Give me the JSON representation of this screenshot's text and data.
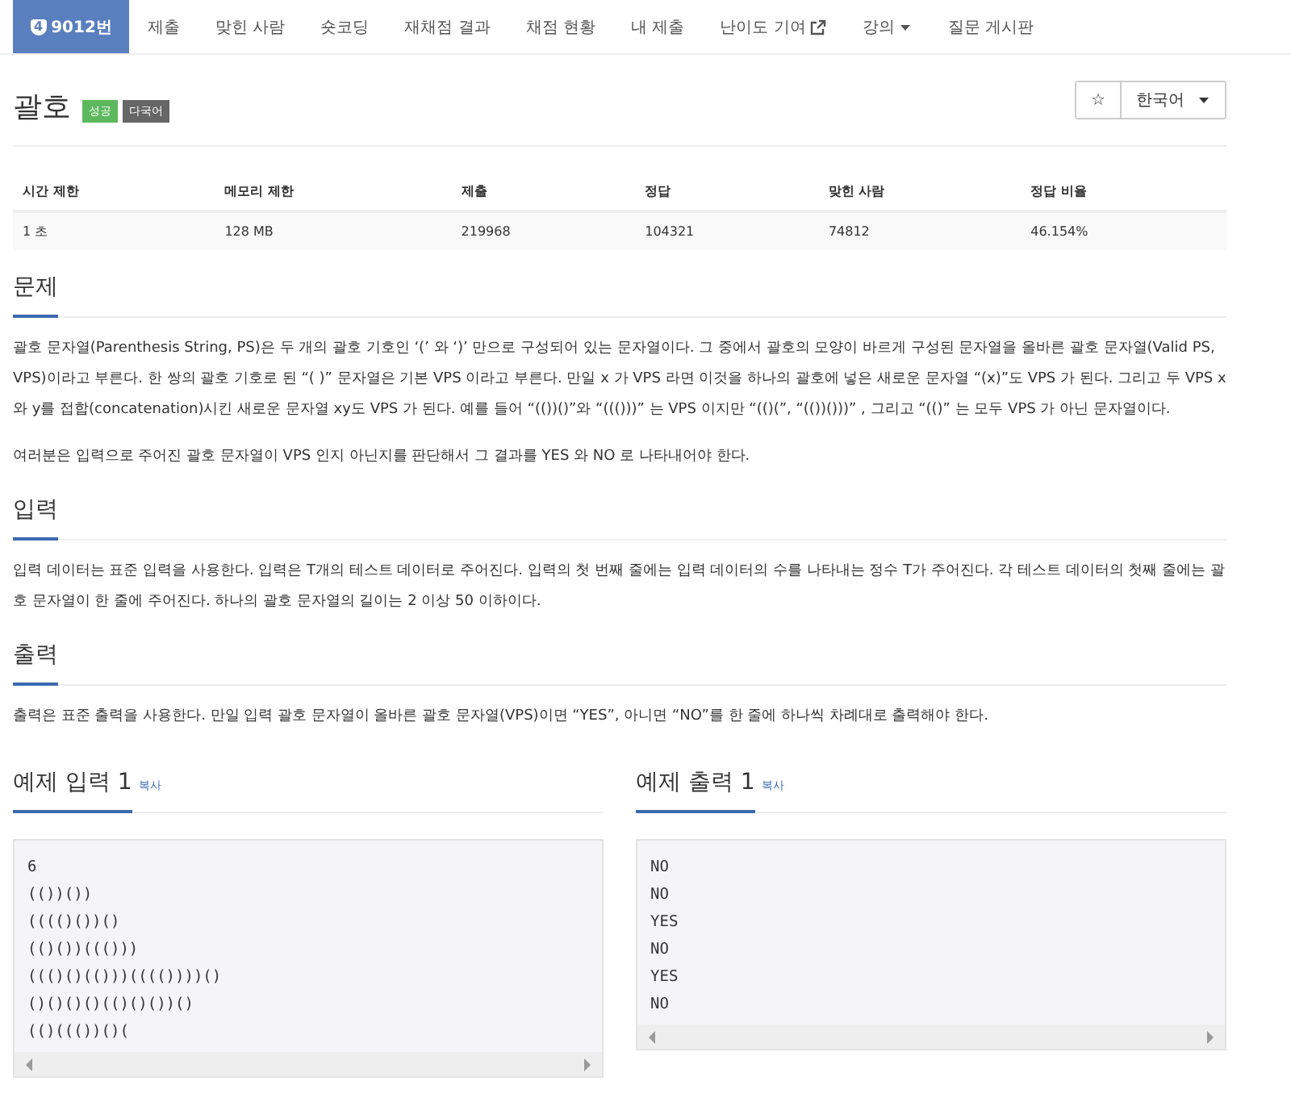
{
  "nav": {
    "items": [
      {
        "kind": "problem",
        "badge": "4",
        "label": "9012번",
        "selected": true
      },
      {
        "kind": "link",
        "label": "제출",
        "selected": false
      },
      {
        "kind": "link",
        "label": "맞힌 사람",
        "selected": false
      },
      {
        "kind": "link",
        "label": "숏코딩",
        "selected": false
      },
      {
        "kind": "link",
        "label": "재채점 결과",
        "selected": false
      },
      {
        "kind": "link",
        "label": "채점 현황",
        "selected": false
      },
      {
        "kind": "link",
        "label": "내 제출",
        "selected": false
      },
      {
        "kind": "external",
        "label": "난이도 기여",
        "selected": false
      },
      {
        "kind": "dropdown",
        "label": "강의",
        "selected": false
      },
      {
        "kind": "link",
        "label": "질문 게시판",
        "selected": false
      }
    ]
  },
  "title": "괄호",
  "labels": [
    {
      "text": "성공",
      "color": "#5cb85c"
    },
    {
      "text": "다국어",
      "color": "#666666"
    }
  ],
  "favorite": {
    "symbol": "☆"
  },
  "language": {
    "label": "한국어"
  },
  "info_table": {
    "columns": [
      "시간 제한",
      "메모리 제한",
      "제출",
      "정답",
      "맞힌 사람",
      "정답 비율"
    ],
    "rows": [
      [
        "1 초",
        "128 MB",
        "219968",
        "104321",
        "74812",
        "46.154%"
      ]
    ]
  },
  "sections": [
    {
      "heading": "문제",
      "paragraphs": [
        "괄호 문자열(Parenthesis String, PS)은 두 개의 괄호 기호인 ‘(’ 와 ‘)’ 만으로 구성되어 있는 문자열이다. 그 중에서 괄호의 모양이 바르게 구성된 문자열을 올바른 괄호 문자열(Valid PS, VPS)이라고 부른다. 한 쌍의 괄호 기호로 된 “( )” 문자열은 기본 VPS 이라고 부른다. 만일 x 가 VPS 라면 이것을 하나의 괄호에 넣은 새로운 문자열 “(x)”도 VPS 가 된다. 그리고 두 VPS x 와 y를 접합(concatenation)시킨 새로운 문자열 xy도 VPS 가 된다. 예를 들어 “(())()”와 “((()))” 는 VPS 이지만 “(()(”, “(())()))” , 그리고 “(()” 는 모두 VPS 가 아닌 문자열이다.",
        "여러분은 입력으로 주어진 괄호 문자열이 VPS 인지 아닌지를 판단해서 그 결과를 YES 와 NO 로 나타내어야 한다."
      ]
    },
    {
      "heading": "입력",
      "paragraphs": [
        "입력 데이터는 표준 입력을 사용한다. 입력은 T개의 테스트 데이터로 주어진다. 입력의 첫 번째 줄에는 입력 데이터의 수를 나타내는 정수 T가 주어진다. 각 테스트 데이터의 첫째 줄에는 괄호 문자열이 한 줄에 주어진다. 하나의 괄호 문자열의 길이는 2 이상 50 이하이다."
      ]
    },
    {
      "heading": "출력",
      "paragraphs": [
        "출력은 표준 출력을 사용한다. 만일 입력 괄호 문자열이 올바른 괄호 문자열(VPS)이면 “YES”, 아니면 “NO”를 한 줄에 하나씩 차례대로 출력해야 한다."
      ]
    }
  ],
  "samples": [
    {
      "heading": "예제 입력 1",
      "copy": "복사",
      "lines": [
        "6",
        "(())())",
        "(((()())()",
        "(()())((()))",
        "((()()(()))(((())))()",
        "()()()()(()()())()",
        "(()((())()("
      ]
    },
    {
      "heading": "예제 출력 1",
      "copy": "복사",
      "lines": [
        "NO",
        "NO",
        "YES",
        "NO",
        "YES",
        "NO"
      ]
    }
  ]
}
